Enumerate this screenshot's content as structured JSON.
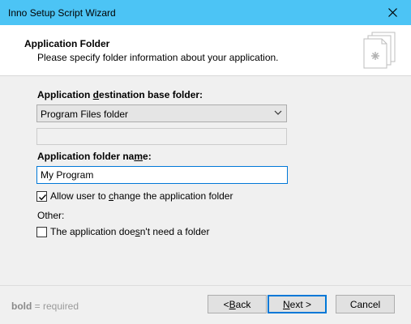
{
  "window": {
    "title": "Inno Setup Script Wizard"
  },
  "header": {
    "title": "Application Folder",
    "subtitle": "Please specify folder information about your application."
  },
  "form": {
    "dest_label_pre": "Application ",
    "dest_label_u": "d",
    "dest_label_post": "estination base folder:",
    "dest_select_value": "Program Files folder",
    "name_label_pre": "Application folder na",
    "name_label_u": "m",
    "name_label_post": "e:",
    "name_value": "My Program",
    "allow_change": {
      "pre": "Allow user to ",
      "u": "c",
      "post": "hange the application folder",
      "checked": true
    },
    "other_label": "Other:",
    "no_folder": {
      "pre": "The application doe",
      "u": "s",
      "post": "n't need a folder",
      "checked": false
    }
  },
  "footer": {
    "hint_bold": "bold",
    "hint_rest": " = required",
    "back": {
      "pre": "< ",
      "u": "B",
      "post": "ack"
    },
    "next": {
      "u": "N",
      "post": "ext >"
    },
    "cancel": "Cancel"
  }
}
